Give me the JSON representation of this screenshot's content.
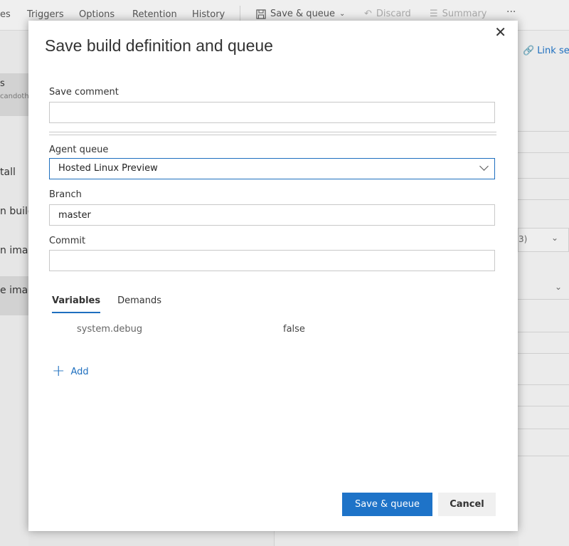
{
  "toolbar": {
    "tabs": [
      "es",
      "Triggers",
      "Options",
      "Retention",
      "History"
    ],
    "save_queue": "Save & queue",
    "discard": "Discard",
    "summary": "Summary",
    "more": "···"
  },
  "left_list": {
    "header_line1": "s",
    "header_line2": "candoth",
    "items": [
      "tall",
      "n build",
      "n imag",
      "e imag"
    ]
  },
  "right_panel": {
    "link_settings": "Link set",
    "select_fragment": "3)"
  },
  "dialog": {
    "title": "Save build definition and queue",
    "save_comment_label": "Save comment",
    "save_comment_value": "",
    "agent_queue_label": "Agent queue",
    "agent_queue_value": "Hosted Linux Preview",
    "branch_label": "Branch",
    "branch_value": "master",
    "commit_label": "Commit",
    "commit_value": "",
    "tabs": [
      "Variables",
      "Demands"
    ],
    "variables": [
      {
        "name": "system.debug",
        "value": "false"
      }
    ],
    "add_label": "Add",
    "save_queue_button": "Save & queue",
    "cancel_button": "Cancel"
  },
  "colors": {
    "accent": "#1e73c8",
    "link": "#1e6fbf"
  }
}
